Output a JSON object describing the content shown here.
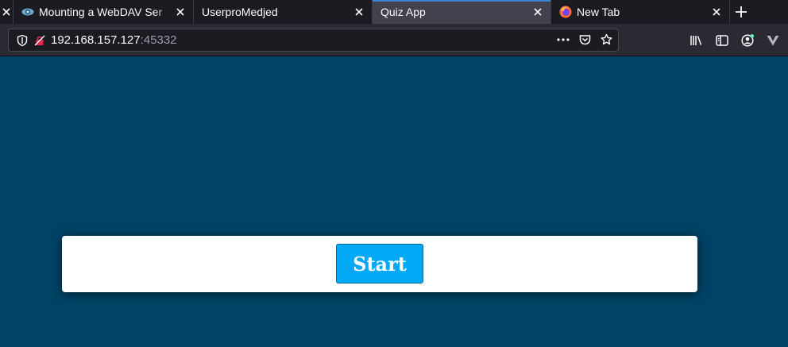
{
  "browser": {
    "tabs": [
      {
        "label": "",
        "favicon": "close-icon",
        "active": false
      },
      {
        "label": "Mounting a WebDAV Ser",
        "favicon": "webdav-favicon",
        "active": false
      },
      {
        "label": "UserproMedjed",
        "favicon": "",
        "active": false
      },
      {
        "label": "Quiz App",
        "favicon": "",
        "active": true
      },
      {
        "label": "New Tab",
        "favicon": "firefox-favicon",
        "active": false
      }
    ],
    "address": {
      "host": "192.168.157.127",
      "port": ":45332"
    },
    "accent_color": "#3b82d0"
  },
  "page": {
    "background_color": "#004366",
    "start_button": {
      "label": "Start",
      "color": "#03a9f4"
    }
  }
}
